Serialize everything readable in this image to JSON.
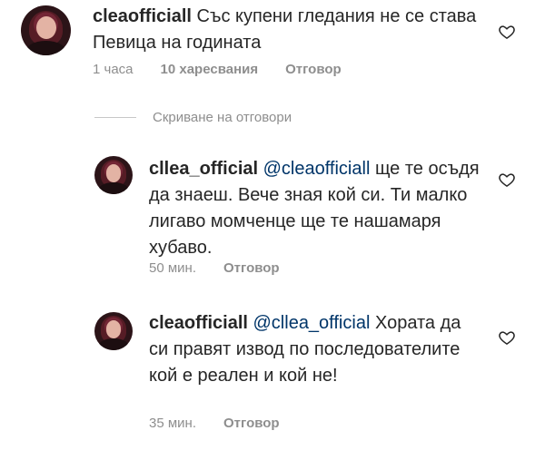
{
  "comments": [
    {
      "username": "cleaofficiall",
      "mention": "",
      "text": "Със купени гледания не се става Певица на годината",
      "time": "1 часа",
      "likes": "10 харесвания",
      "reply_label": "Отговор"
    },
    {
      "username": "cllea_official",
      "mention": "@cleaofficiall",
      "text": "ще те осъдя да знаеш. Вече зная кой си. Ти малко лигаво момченце ще те нашамаря хубаво.",
      "time": "50 мин.",
      "reply_label": "Отговор"
    },
    {
      "username": "cleaofficiall",
      "mention": "@cllea_official",
      "text": "Хората да си правят извод по последователите кой е реален и кой не!",
      "time": "35 мин.",
      "reply_label": "Отговор"
    }
  ],
  "hide_replies_label": "Скриване на отговори",
  "icons": {
    "like": "heart-outline-icon",
    "avatar": "profile-photo"
  }
}
